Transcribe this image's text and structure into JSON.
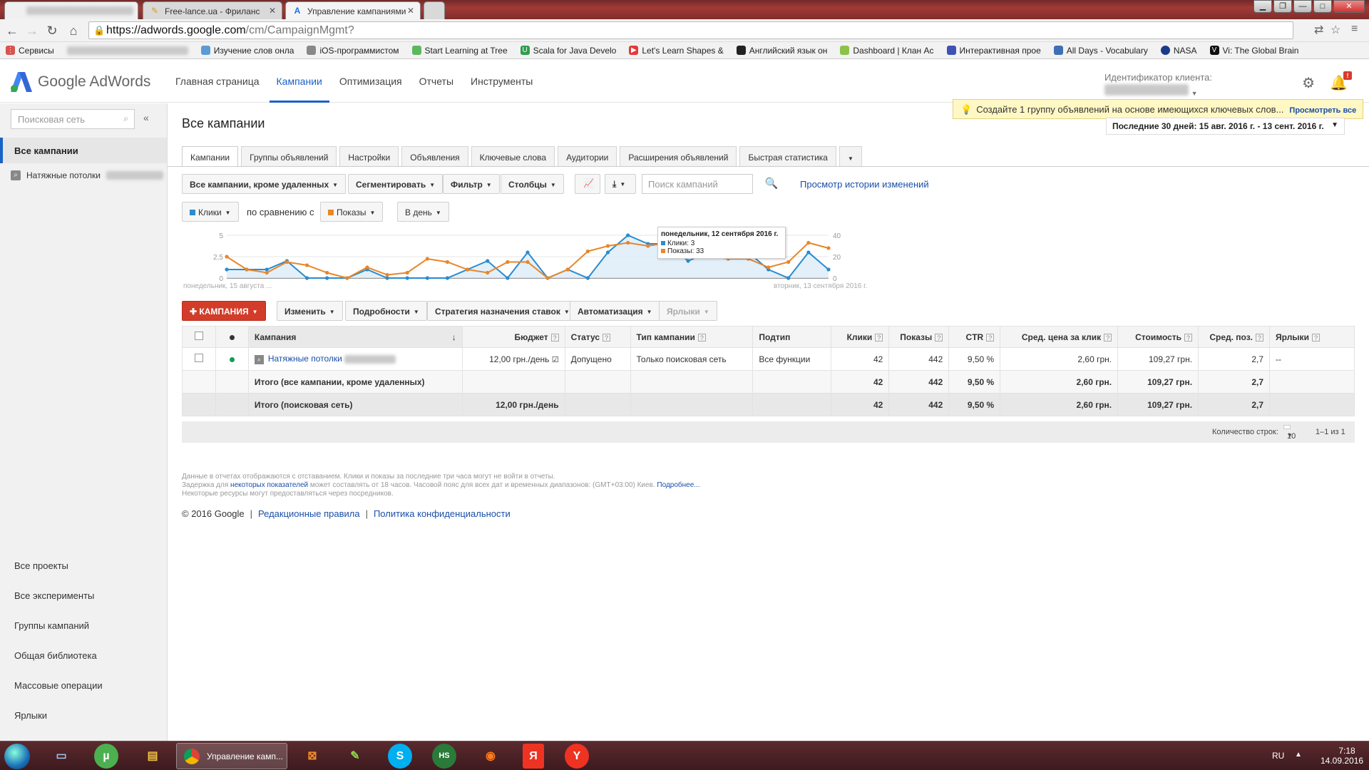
{
  "browser": {
    "tabs": [
      {
        "title": "Free-lance.ua - Фриланс"
      },
      {
        "title": "Управление кампаниями"
      }
    ],
    "url_main": "https://adwords.google.com",
    "url_path": "/cm/CampaignMgmt?",
    "bookmarks": [
      {
        "label": "Сервисы",
        "color": "#d9534f"
      },
      {
        "label": "Изучение слов онла",
        "color": "#5b9bd5"
      },
      {
        "label": "iOS-программистом",
        "color": "#888888"
      },
      {
        "label": "Start Learning at Tree",
        "color": "#5cb85c"
      },
      {
        "label": "Scala for Java Develo",
        "color": "#2e9e4e"
      },
      {
        "label": "Let's Learn Shapes &",
        "color": "#e53935"
      },
      {
        "label": "Английский язык он",
        "color": "#222222"
      },
      {
        "label": "Dashboard | Клан Ас",
        "color": "#8bc34a"
      },
      {
        "label": "Интерактивная прое",
        "color": "#3f51b5"
      },
      {
        "label": "All Days - Vocabulary",
        "color": "#3f6fb5"
      },
      {
        "label": "NASA",
        "color": "#1a3a8a"
      },
      {
        "label": "Vi: The Global Brain",
        "color": "#111111"
      }
    ]
  },
  "header": {
    "logo": "Google AdWords",
    "nav": [
      "Главная страница",
      "Кампании",
      "Оптимизация",
      "Отчеты",
      "Инструменты"
    ],
    "client_id_label": "Идентификатор клиента:",
    "notif_badge": "!"
  },
  "sidebar": {
    "search_placeholder": "Поисковая сеть",
    "all_campaigns": "Все кампании",
    "campaign": "Натяжные потолки",
    "links": [
      "Все проекты",
      "Все эксперименты",
      "Группы кампаний",
      "Общая библиотека",
      "Массовые операции",
      "Ярлыки"
    ]
  },
  "main": {
    "title": "Все кампании",
    "promo_text": "Создайте 1 группу объявлений на основе имеющихся ключевых слов...",
    "promo_link": "Просмотреть все",
    "date_range": "Последние 30 дней: 15 авг. 2016 г. - 13 сент. 2016 г.",
    "tabs": [
      "Кампании",
      "Группы объявлений",
      "Настройки",
      "Объявления",
      "Ключевые слова",
      "Аудитории",
      "Расширения объявлений",
      "Быстрая статистика"
    ],
    "filter_all": "Все кампании, кроме удаленных",
    "segment": "Сегментировать",
    "filter": "Фильтр",
    "columns": "Столбцы",
    "search_placeholder": "Поиск кампаний",
    "history_link": "Просмотр истории изменений",
    "metric1": "Клики",
    "compare_label": "по сравнению с",
    "metric2": "Показы",
    "granularity": "В день",
    "actions": {
      "add_campaign": "КАМПАНИЯ",
      "edit": "Изменить",
      "details": "Подробности",
      "bid_strategy": "Стратегия назначения ставок",
      "automation": "Автоматизация",
      "labels": "Ярлыки"
    }
  },
  "chart_data": {
    "type": "line",
    "x_start_label": "понедельник, 15 августа ...",
    "x_end_label": "вторник, 13 сентября 2016 г.",
    "y_left_ticks": [
      "5",
      "2,5",
      "0"
    ],
    "y_right_ticks": [
      "40",
      "20",
      "0"
    ],
    "y_left_lim": [
      0,
      5
    ],
    "y_right_lim": [
      0,
      40
    ],
    "series": [
      {
        "name": "Клики",
        "axis": "left",
        "color": "#2a8bd0",
        "values": [
          1,
          1,
          1,
          2,
          0,
          0,
          0,
          1,
          0,
          0,
          0,
          0,
          1,
          2,
          0,
          3,
          0,
          1,
          0,
          3,
          5,
          4,
          4,
          2,
          3,
          3,
          3,
          1,
          0,
          3,
          1
        ]
      },
      {
        "name": "Показы",
        "axis": "right",
        "color": "#e8862a",
        "values": [
          20,
          8,
          5,
          15,
          12,
          5,
          0,
          10,
          3,
          5,
          18,
          15,
          8,
          5,
          15,
          15,
          0,
          8,
          25,
          30,
          33,
          30,
          33,
          28,
          20,
          18,
          18,
          10,
          15,
          33,
          28
        ]
      }
    ],
    "tooltip": {
      "date": "понедельник, 12 сентября 2016 г.",
      "clicks": "Клики: 3",
      "impressions": "Показы: 33"
    }
  },
  "table": {
    "headers": [
      "Кампания",
      "Бюджет",
      "Статус",
      "Тип кампании",
      "Подтип",
      "Клики",
      "Показы",
      "CTR",
      "Сред. цена за клик",
      "Стоимость",
      "Сред. поз.",
      "Ярлыки"
    ],
    "row": {
      "campaign": "Натяжные потолки",
      "budget": "12,00 грн./день",
      "status": "Допущено",
      "type": "Только поисковая сеть",
      "subtype": "Все функции",
      "clicks": "42",
      "impressions": "442",
      "ctr": "9,50 %",
      "avg_cpc": "2,60 грн.",
      "cost": "109,27 грн.",
      "avg_pos": "2,7",
      "labels": "--"
    },
    "total1": {
      "label": "Итого (все кампании, кроме удаленных)",
      "clicks": "42",
      "impressions": "442",
      "ctr": "9,50 %",
      "avg_cpc": "2,60 грн.",
      "cost": "109,27 грн.",
      "avg_pos": "2,7"
    },
    "total2": {
      "label": "Итого (поисковая сеть)",
      "budget": "12,00 грн./день",
      "clicks": "42",
      "impressions": "442",
      "ctr": "9,50 %",
      "avg_cpc": "2,60 грн.",
      "cost": "109,27 грн.",
      "avg_pos": "2,7"
    },
    "rows_label": "Количество строк:",
    "rows_value": "10",
    "pagination": "1–1 из 1"
  },
  "notes": {
    "line1": "Данные в отчетах отображаются с отставанием. Клики и показы за последние три часа могут не войти в отчеты.",
    "line2_a": "Задержка для ",
    "line2_link": "некоторых показателей",
    "line2_b": " может составлять от 18 часов. Часовой пояс для всех дат и временных диапазонов: (GMT+03:00) Киев. ",
    "line2_more": "Подробнее...",
    "line3": "Некоторые ресурсы могут предоставляться через посредников."
  },
  "footer": {
    "copyright": "© 2016 Google",
    "policy": "Редакционные правила",
    "privacy": "Политика конфиденциальности"
  },
  "taskbar": {
    "chrome_label": "Управление камп...",
    "lang": "RU",
    "time": "7:18",
    "date": "14.09.2016"
  }
}
